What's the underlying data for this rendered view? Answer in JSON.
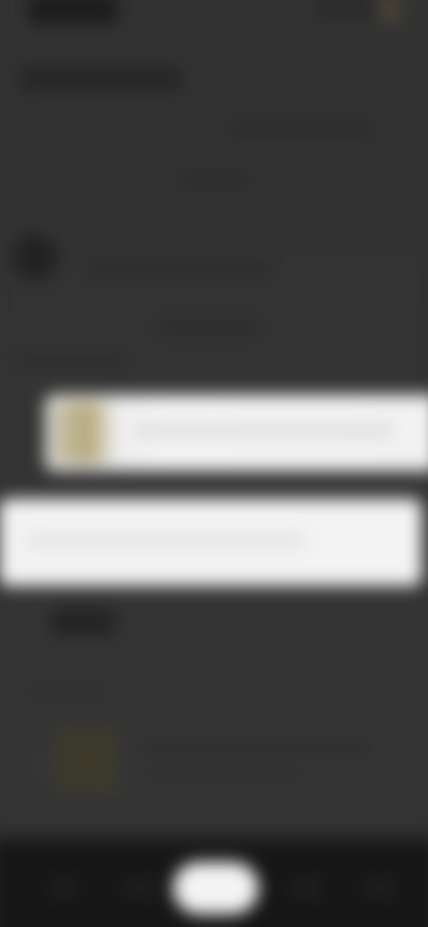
{
  "status_bar": {
    "time": "",
    "icons": [
      "signal-icon",
      "wifi-icon",
      "battery-icon"
    ]
  },
  "header": {
    "title": "",
    "subtitle": "",
    "link": ""
  },
  "profile": {
    "name": "",
    "detail": ""
  },
  "sections": {
    "label": ""
  },
  "rows": [
    {
      "label": ""
    },
    {
      "label": ""
    }
  ],
  "list": [
    {
      "title": "",
      "subtitle": ""
    }
  ],
  "bottom_nav": {
    "items": [
      "",
      "",
      "",
      "",
      ""
    ]
  },
  "colors": {
    "background": "#333333",
    "highlight_row": "#f2f2f2",
    "thumbnail_accent": "#b3a679",
    "bottom_nav": "#161616"
  }
}
